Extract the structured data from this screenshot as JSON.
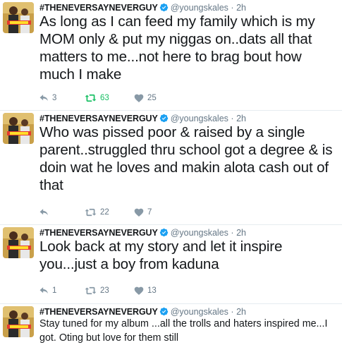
{
  "tweets": [
    {
      "name": "#THENEVERSAYNEVERGUY",
      "handle": "@youngskales",
      "time": "2h",
      "text": "As long as I can feed my family which is my MOM only & put my niggas on..dats all that matters to me...not here to brag bout how much I make",
      "replies": "3",
      "retweets": "63",
      "likes": "25",
      "retweeted": true
    },
    {
      "name": "#THENEVERSAYNEVERGUY",
      "handle": "@youngskales",
      "time": "2h",
      "text": "Who was pissed poor & raised by a single parent..struggled thru school got a degree & is doin wat he loves and makin alota cash out of that",
      "replies": "",
      "retweets": "22",
      "likes": "7",
      "retweeted": false
    },
    {
      "name": "#THENEVERSAYNEVERGUY",
      "handle": "@youngskales",
      "time": "2h",
      "text": "Look back at my story and let it inspire you...just a boy from kaduna",
      "replies": "1",
      "retweets": "23",
      "likes": "13",
      "retweeted": false
    },
    {
      "name": "#THENEVERSAYNEVERGUY",
      "handle": "@youngskales",
      "time": "2h",
      "text": "Stay tuned for my album ...all the trolls and haters inspired me...I got. Oting but love for them still"
    }
  ],
  "separator": "·",
  "icons": {
    "reply": "reply-icon",
    "retweet": "retweet-icon",
    "like": "heart-icon",
    "verified": "verified-badge-icon"
  },
  "colors": {
    "verified": "#1da1f2",
    "retweet_active": "#17bf63",
    "muted": "#657786",
    "text": "#14171a"
  }
}
